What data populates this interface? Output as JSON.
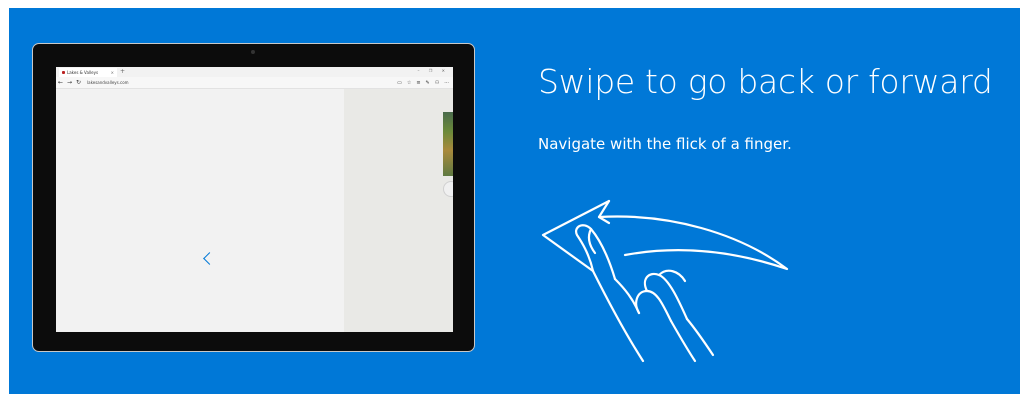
{
  "heading": "Swipe to go back or forward",
  "subheading": "Navigate with the flick of a finger.",
  "browser": {
    "tab_title": "Lakes & Valleys",
    "tab_close": "×",
    "new_tab": "+",
    "url": "lakesandvalleys.com",
    "nav": {
      "back": "←",
      "forward": "→",
      "refresh": "↻"
    },
    "window_controls": "– ❐ ✕",
    "toolbar_icons": [
      "reading-view-icon",
      "favorite-star-icon",
      "hub-icon",
      "web-note-icon",
      "share-icon",
      "more-icon"
    ],
    "toolbar_glyphs": {
      "reading_view": "▭",
      "favorite": "☆",
      "hub": "≡",
      "web_note": "✎",
      "share": "⚇",
      "more": "···"
    }
  },
  "colors": {
    "background": "#0078d7",
    "text": "#ffffff",
    "device": "#0c0c0c"
  }
}
